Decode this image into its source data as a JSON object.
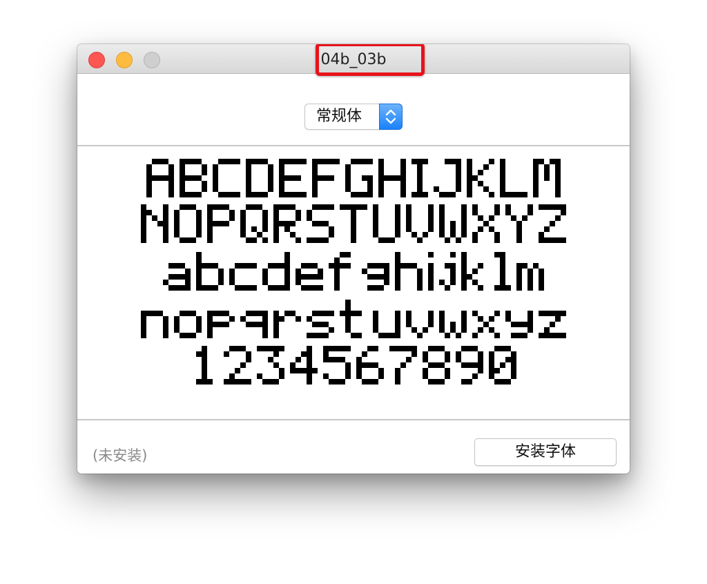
{
  "window": {
    "title": "04b_03b"
  },
  "style_selector": {
    "selected": "常规体"
  },
  "specimen": {
    "lines": [
      "ABCDEFGHIJKLM",
      "NOPQRSTUVWXYZ",
      "abcdefghijklm",
      "nopqrstuvwxyz",
      "1234567890"
    ]
  },
  "footer": {
    "status": "(未安装)",
    "install_label": "安装字体"
  },
  "colors": {
    "highlight_border": "#e8131b",
    "stepper_blue": "#1a82fb",
    "close_red": "#fc5753",
    "minimize_yellow": "#fdbc40",
    "zoom_gray": "#cfcfcf"
  }
}
